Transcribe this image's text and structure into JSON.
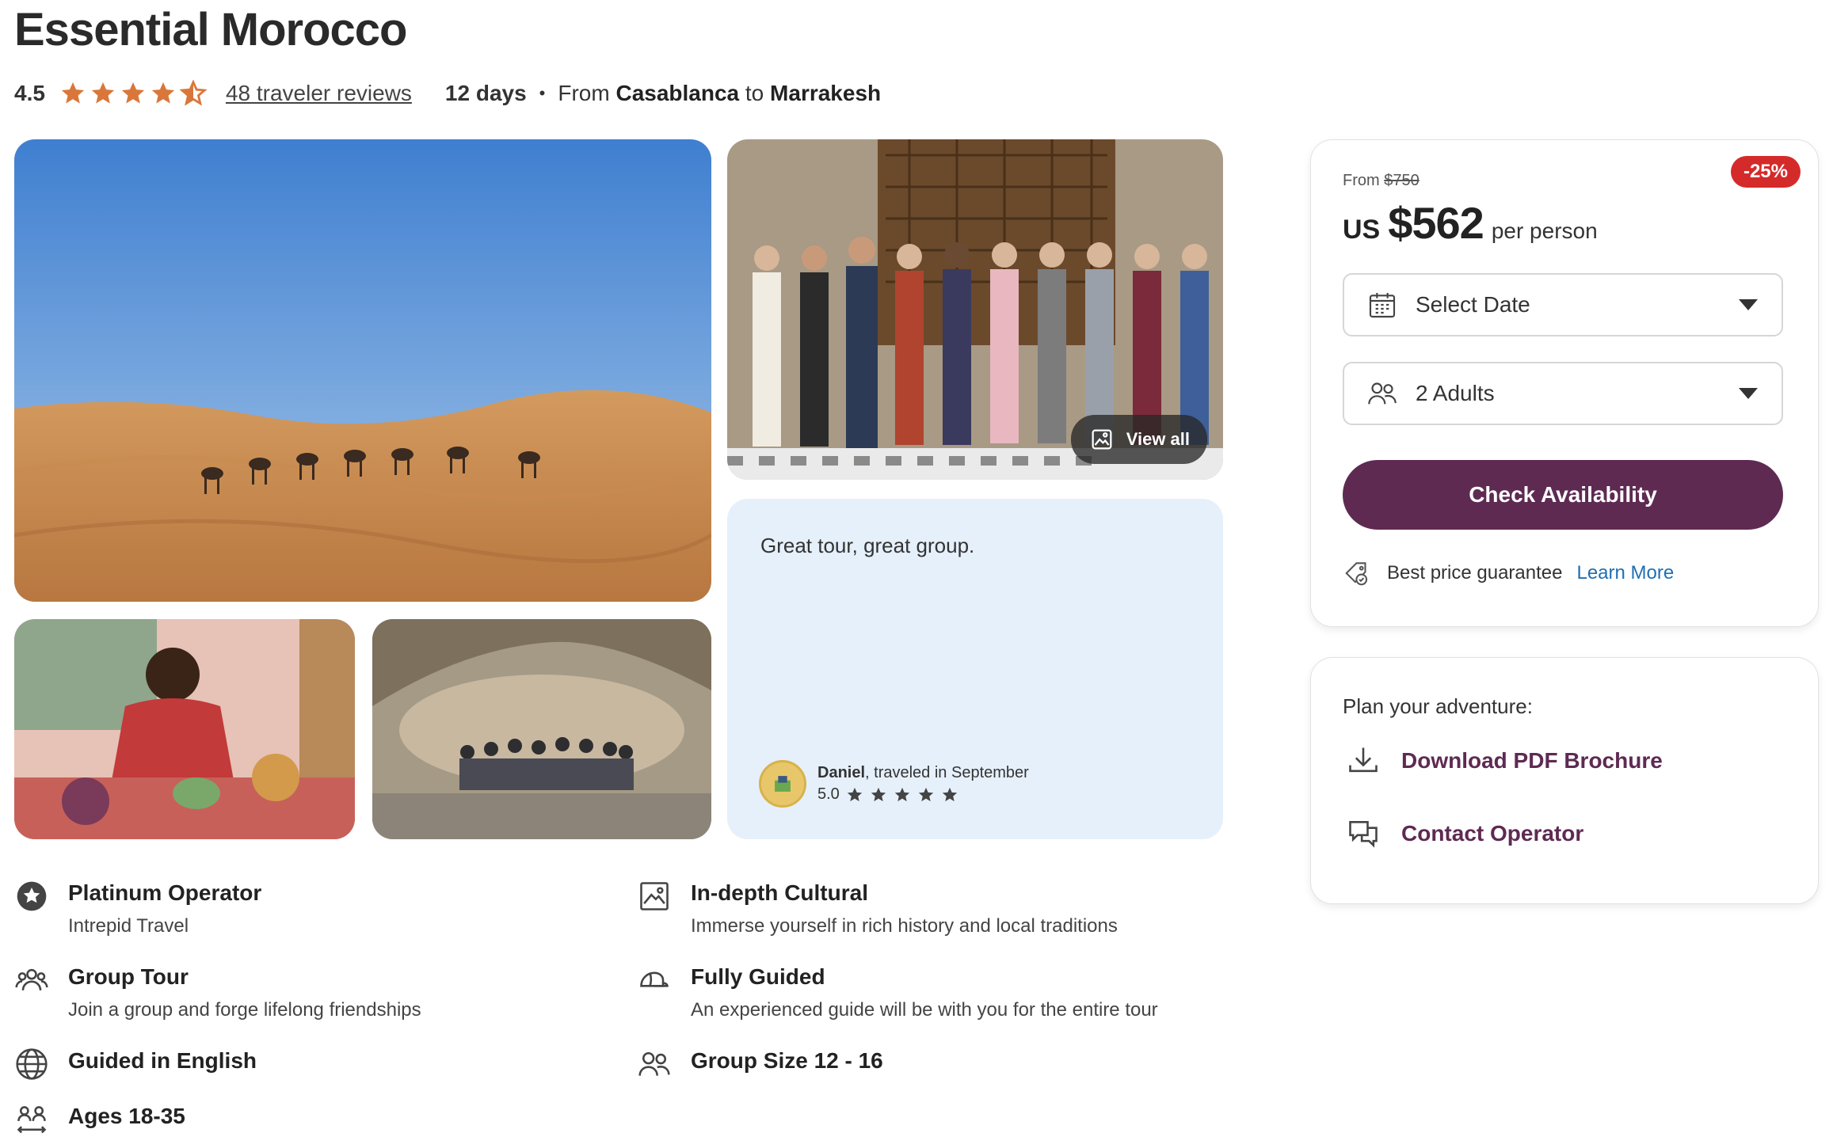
{
  "tour": {
    "title": "Essential Morocco",
    "rating": "4.5",
    "reviews_link": "48 traveler reviews",
    "duration": "12 days",
    "route_from_prefix": "From",
    "route_from": "Casablanca",
    "route_to_prefix": "to",
    "route_to": "Marrakesh"
  },
  "gallery": {
    "view_all_label": "View all"
  },
  "review": {
    "text": "Great tour, great group.",
    "reviewer_name": "Daniel",
    "reviewer_travel": ", traveled in September",
    "score": "5.0"
  },
  "features": [
    {
      "name": "Platinum Operator",
      "desc": "Intrepid Travel",
      "icon": "star-badge-icon"
    },
    {
      "name": "In-depth Cultural",
      "desc": "Immerse yourself in rich history and local traditions",
      "icon": "image-icon"
    },
    {
      "name": "Group Tour",
      "desc": "Join a group and forge lifelong friendships",
      "icon": "group-icon"
    },
    {
      "name": "Fully Guided",
      "desc": "An experienced guide will be with you for the entire tour",
      "icon": "guide-cap-icon"
    },
    {
      "name": "Guided in English",
      "desc": "",
      "icon": "globe-icon"
    },
    {
      "name": "Group Size 12 - 16",
      "desc": "",
      "icon": "people-icon"
    },
    {
      "name": "Ages 18-35",
      "desc": "",
      "icon": "ages-icon"
    }
  ],
  "booking": {
    "discount": "-25%",
    "from_label": "From",
    "original_price": "$750",
    "currency": "US",
    "price": "$562",
    "per_person": "per person",
    "date_select": "Select Date",
    "travelers_select": "2 Adults",
    "cta": "Check Availability",
    "guarantee": "Best price guarantee",
    "learn_more": "Learn More"
  },
  "plan": {
    "title": "Plan your adventure:",
    "download": "Download PDF Brochure",
    "contact": "Contact Operator"
  },
  "colors": {
    "star": "#d9773a",
    "cta": "#5e2a52",
    "discount": "#d52a2a",
    "link": "#1f6fb2",
    "review_bg": "#e6f0fb"
  }
}
